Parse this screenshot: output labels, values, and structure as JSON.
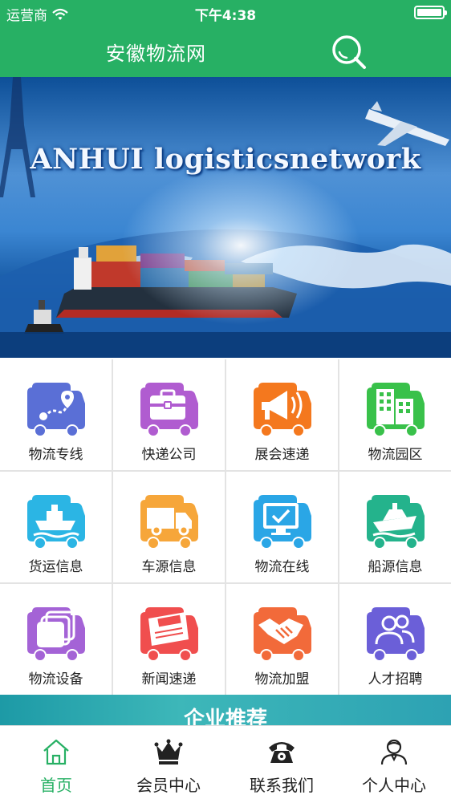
{
  "status_bar": {
    "carrier": "运营商",
    "time": "下午4:38"
  },
  "header": {
    "title": "安徽物流网"
  },
  "banner": {
    "text": "ANHUI logisticsnetwork"
  },
  "grid": [
    {
      "label": "物流专线",
      "icon": "route-map-icon",
      "color": "#5a6fd6"
    },
    {
      "label": "快递公司",
      "icon": "briefcase-icon",
      "color": "#b05cd0"
    },
    {
      "label": "展会速递",
      "icon": "megaphone-icon",
      "color": "#f4781e"
    },
    {
      "label": "物流园区",
      "icon": "buildings-icon",
      "color": "#39c14a"
    },
    {
      "label": "货运信息",
      "icon": "cargo-ship-icon",
      "color": "#2bb5e4"
    },
    {
      "label": "车源信息",
      "icon": "truck-icon",
      "color": "#f6a63a"
    },
    {
      "label": "物流在线",
      "icon": "monitor-check-icon",
      "color": "#2aa6e6"
    },
    {
      "label": "船源信息",
      "icon": "ship-icon",
      "color": "#24b38c"
    },
    {
      "label": "物流设备",
      "icon": "layers-icon",
      "color": "#a463d6"
    },
    {
      "label": "新闻速递",
      "icon": "newspaper-icon",
      "color": "#f04e4e"
    },
    {
      "label": "物流加盟",
      "icon": "handshake-icon",
      "color": "#f26a3a"
    },
    {
      "label": "人才招聘",
      "icon": "people-icon",
      "color": "#6b5fd8"
    }
  ],
  "recommend": {
    "title": "企业推荐"
  },
  "tabs": [
    {
      "label": "首页",
      "icon": "home-icon",
      "active": true
    },
    {
      "label": "会员中心",
      "icon": "crown-icon",
      "active": false
    },
    {
      "label": "联系我们",
      "icon": "telephone-icon",
      "active": false
    },
    {
      "label": "个人中心",
      "icon": "user-icon",
      "active": false
    }
  ],
  "colors": {
    "brand": "#27b064",
    "active_tab": "#27b064"
  }
}
